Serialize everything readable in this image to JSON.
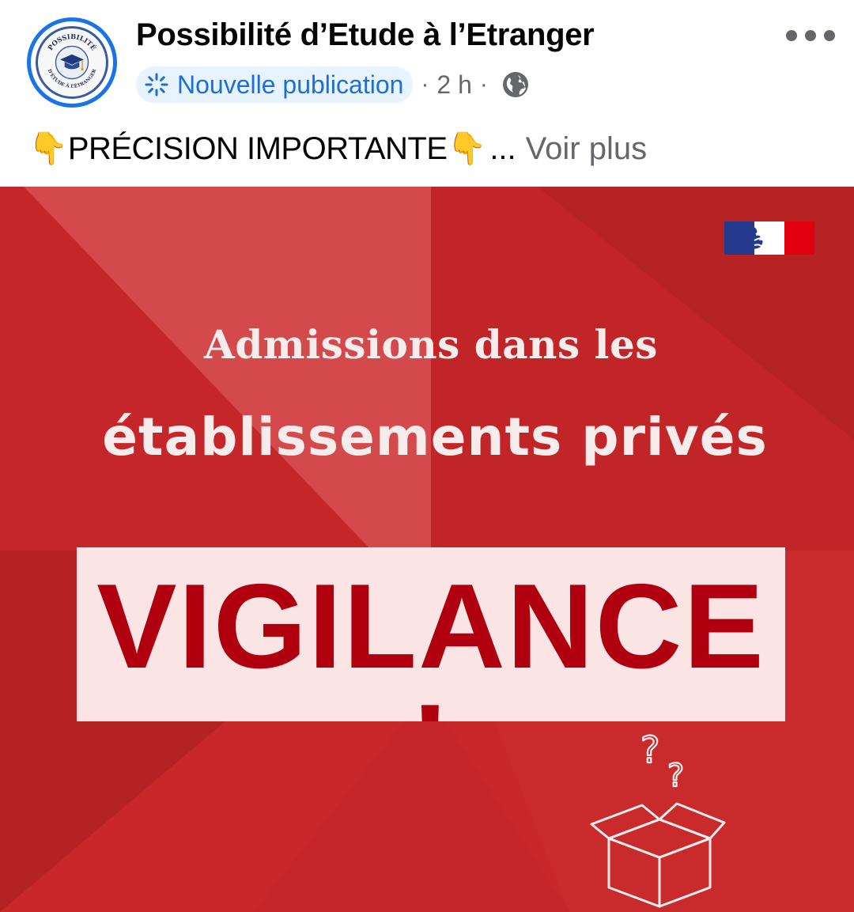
{
  "post": {
    "page_name": "Possibilité d’Etude à l’Etranger",
    "avatar_lines": [
      "POSSIBILITÉ",
      "D’ÉTUDE À L’ÉTRANGER"
    ],
    "new_post_label": "Nouvelle publication",
    "separator": "·",
    "time": "2 h",
    "text": "PRÉCISION IMPORTANTE",
    "emoji": "👇",
    "ellipsis": "...",
    "see_more": "Voir plus"
  },
  "image": {
    "headline_line1": "Admissions dans les",
    "headline_line2": "établissements privés",
    "banner_text": "VIGILANCE !",
    "question_marks": "??"
  },
  "colors": {
    "brand_blue": "#1b74e4",
    "pill_bg": "#e7f3ff",
    "secondary_text": "#65676b",
    "poster_red": "#c8282a",
    "banner_bg": "#fbe4e4",
    "banner_text": "#b00010"
  },
  "icons": [
    "more-options-icon",
    "new-post-sparkle-icon",
    "public-globe-icon",
    "pointing-down-emoji",
    "french-government-logo",
    "open-box-icon",
    "question-mark-icon"
  ]
}
